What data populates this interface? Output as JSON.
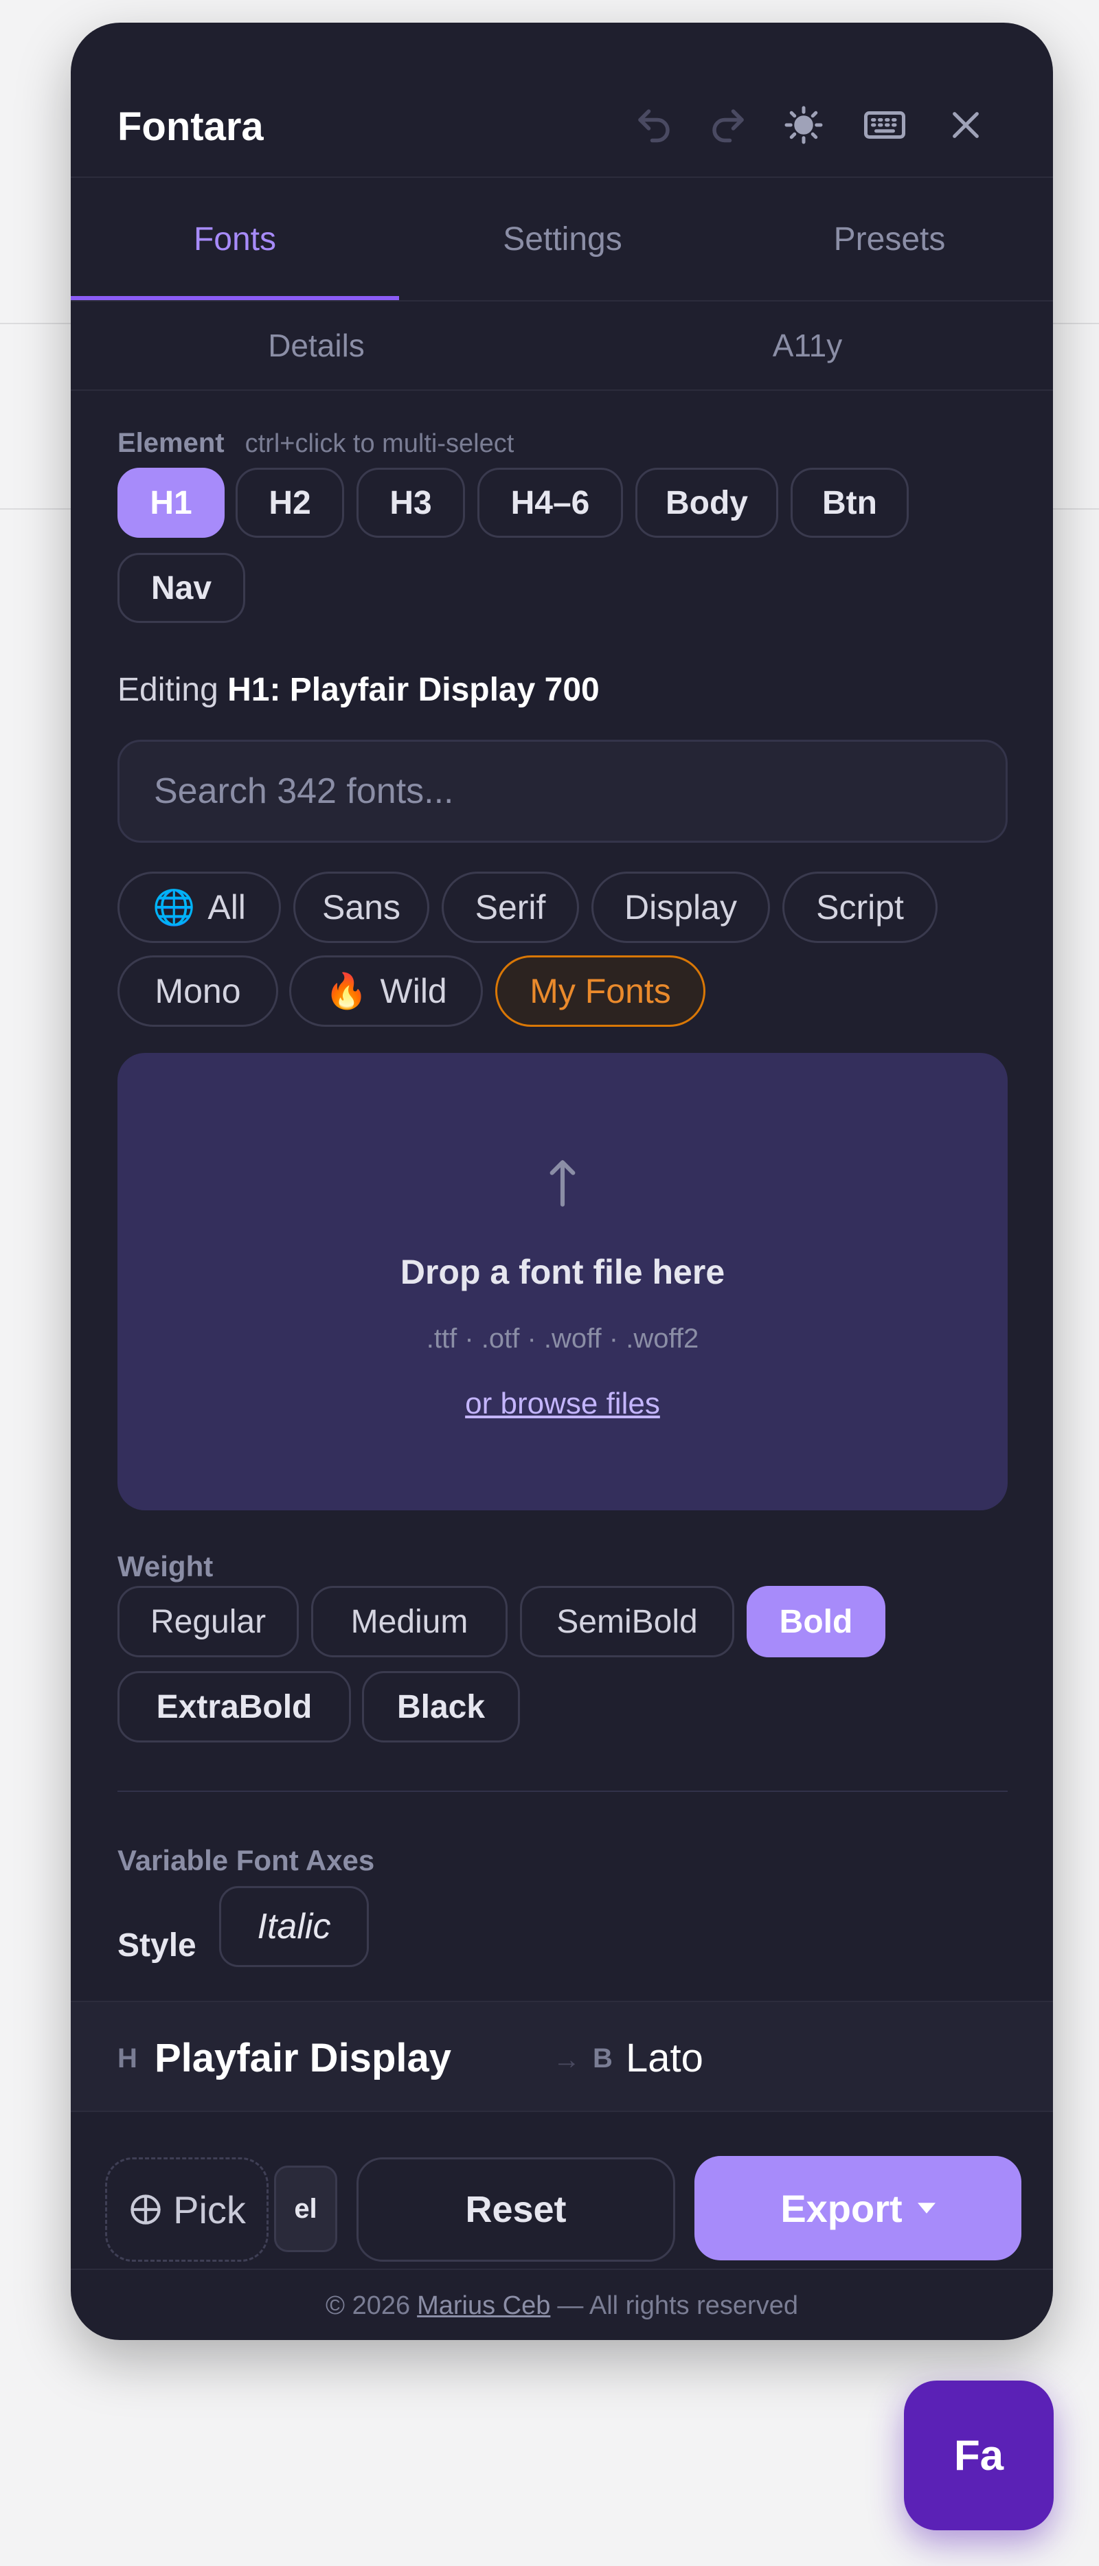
{
  "app": {
    "title": "Fontara"
  },
  "header": {
    "icons": [
      "undo-icon",
      "redo-icon",
      "sun-icon",
      "keyboard-icon",
      "close-icon"
    ]
  },
  "tabs": {
    "primary": [
      "Fonts",
      "Settings",
      "Presets"
    ],
    "secondary": [
      "Details",
      "A11y"
    ],
    "active": "Fonts"
  },
  "element": {
    "label": "Element",
    "hint": "ctrl+click to multi-select",
    "chips": [
      "H1",
      "H2",
      "H3",
      "H4–6",
      "Body",
      "Btn",
      "Nav"
    ],
    "active": "H1"
  },
  "editing": {
    "prefix": "Editing ",
    "value": "H1: Playfair Display 700"
  },
  "search": {
    "placeholder": "Search 342 fonts..."
  },
  "categories": {
    "pills": [
      {
        "label": "All",
        "emoji": "🌐"
      },
      {
        "label": "Sans"
      },
      {
        "label": "Serif"
      },
      {
        "label": "Display"
      },
      {
        "label": "Script"
      },
      {
        "label": "Mono"
      },
      {
        "label": "Wild",
        "emoji": "🔥"
      },
      {
        "label": "My Fonts"
      }
    ],
    "active": "My Fonts"
  },
  "dropzone": {
    "title": "Drop a font file here",
    "types": ".ttf · .otf · .woff · .woff2",
    "browse": "or browse files"
  },
  "weight": {
    "label": "Weight",
    "options": [
      "Regular",
      "Medium",
      "SemiBold",
      "Bold",
      "ExtraBold",
      "Black"
    ],
    "active": "Bold"
  },
  "axes": {
    "label": "Variable Font Axes",
    "style_label": "Style",
    "style_value": "Italic"
  },
  "preview": {
    "heading_tag": "H",
    "heading_font": "Playfair Display",
    "arrow": "→",
    "body_tag": "B",
    "body_font": "Lato"
  },
  "actions": {
    "pick": "Pick",
    "el": "el",
    "reset": "Reset",
    "export": "Export"
  },
  "footer": {
    "prefix": "© 2026",
    "author": "Marius Ceb",
    "suffix": "— All rights reserved"
  },
  "fab": {
    "label": "Fa"
  },
  "colors": {
    "panel_bg": "#1f1f2e",
    "accent": "#a78bfa",
    "my_fonts_accent": "#d97706",
    "dropzone_bg": "#342f5c",
    "fab_bg": "#5b21b6"
  }
}
